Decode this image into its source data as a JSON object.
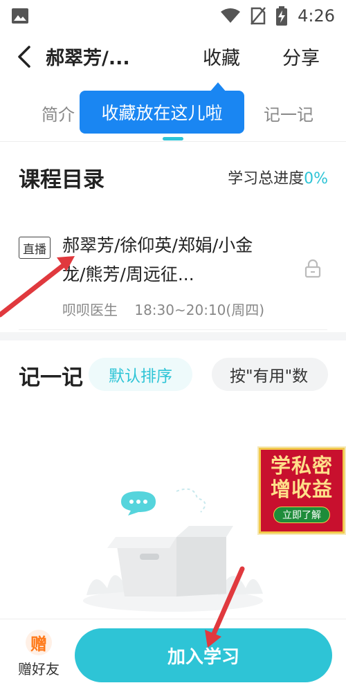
{
  "status_bar": {
    "time": "4:26"
  },
  "header": {
    "title": "郝翠芳/...",
    "favorite_label": "收藏",
    "share_label": "分享"
  },
  "tabs": {
    "intro_label": "简介",
    "notes_label": "记一记"
  },
  "tooltip": {
    "text": "收藏放在这儿啦"
  },
  "course_section": {
    "title": "课程目录",
    "progress_label": "学习总进度",
    "progress_value": "0%",
    "items": [
      {
        "badge": "直播",
        "name": "郝翠芳/徐仰英/郑娟/小金龙/熊芳/周远征...",
        "teacher": "呗呗医生",
        "time": "18:30~20:10(周四)"
      }
    ]
  },
  "notes_section": {
    "title": "记一记",
    "sort_default": "默认排序",
    "sort_useful": "按\"有用\"数"
  },
  "ad": {
    "line1": "学私密",
    "line2": "增收益",
    "button": "立即了解"
  },
  "bottom_bar": {
    "gift_icon": "赠",
    "gift_label": "赠好友",
    "join_label": "加入学习"
  },
  "colors": {
    "accent": "#2ec4d6",
    "tooltip": "#1a86f2",
    "ad_red": "#c8102e",
    "arrow_red": "#e0393e"
  }
}
